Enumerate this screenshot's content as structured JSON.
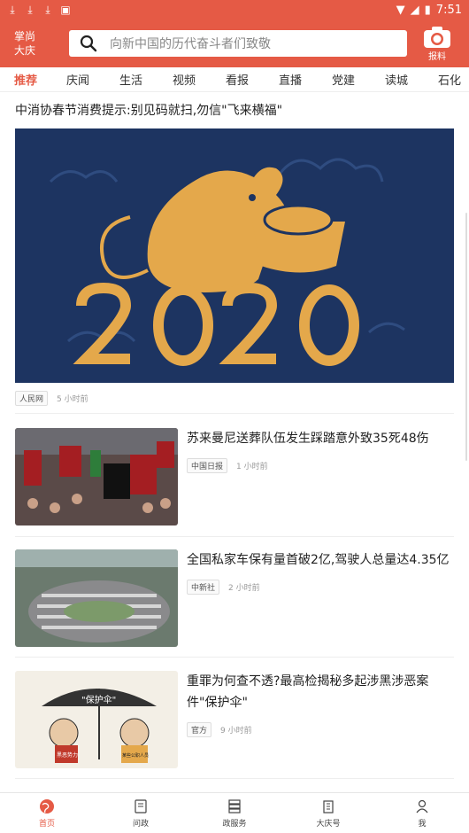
{
  "status": {
    "time": "7:51"
  },
  "header": {
    "brand_line1": "掌尚",
    "brand_line2": "大庆",
    "search_placeholder": "向新中国的历代奋斗者们致敬",
    "report_label": "报料",
    "accent": "#e55a45"
  },
  "tabs": [
    "推荐",
    "庆闻",
    "生活",
    "视频",
    "看报",
    "直播",
    "党建",
    "读城",
    "石化"
  ],
  "feed": {
    "headline": "中消协春节消费提示:别见码就扫,勿信\"飞来横福\"",
    "hero": {
      "source": "人民网",
      "time": "5 小时前",
      "image_text": "2020"
    },
    "items": [
      {
        "title": "苏来曼尼送葬队伍发生踩踏意外致35死48伤",
        "source": "中国日报",
        "time": "1 小时前"
      },
      {
        "title": "全国私家车保有量首破2亿,驾驶人总量达4.35亿",
        "source": "中新社",
        "time": "2 小时前"
      },
      {
        "title": "重罪为何查不透?最高检揭秘多起涉黑涉恶案件\"保护伞\"",
        "source": "官方",
        "time": "9 小时前",
        "image_text": [
          "\"保护伞\"",
          "黑恶势力",
          "某些公职人员"
        ]
      }
    ]
  },
  "bottom_nav": [
    {
      "label": "首页",
      "icon": "globe-icon"
    },
    {
      "label": "问政",
      "icon": "question-doc-icon"
    },
    {
      "label": "政服务",
      "icon": "server-icon"
    },
    {
      "label": "大庆号",
      "icon": "building-icon"
    },
    {
      "label": "我",
      "icon": "user-icon"
    }
  ]
}
